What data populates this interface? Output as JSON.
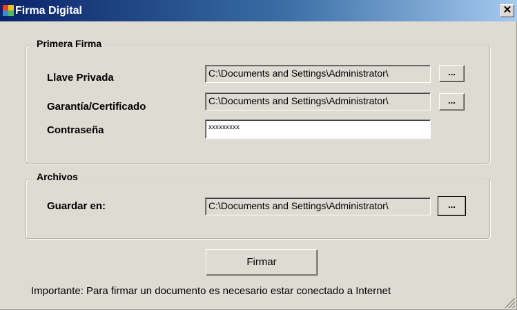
{
  "window": {
    "title": "Firma Digital",
    "icon": "app-window-icon",
    "close_glyph": "✕"
  },
  "primera_firma": {
    "legend": "Primera Firma",
    "llave_privada": {
      "label": "Llave Privada",
      "value": "C:\\Documents and Settings\\Administrator\\",
      "browse_label": "..."
    },
    "garantia": {
      "label": "Garantía/Certificado",
      "value": "C:\\Documents and Settings\\Administrator\\",
      "browse_label": "..."
    },
    "contrasena": {
      "label": "Contraseña",
      "value": "xxxxxxxxx"
    }
  },
  "archivos": {
    "legend": "Archivos",
    "guardar_en": {
      "label": "Guardar en:",
      "value": "C:\\Documents and Settings\\Administrator\\",
      "browse_label": "..."
    }
  },
  "actions": {
    "sign_label": "Firmar"
  },
  "footer": {
    "note": "Importante: Para firmar un documento es necesario estar conectado a Internet"
  },
  "colors": {
    "titlebar_start": "#0a246a",
    "titlebar_end": "#a6caf0",
    "dialog_bg": "#dedbd3",
    "text": "#000000"
  }
}
